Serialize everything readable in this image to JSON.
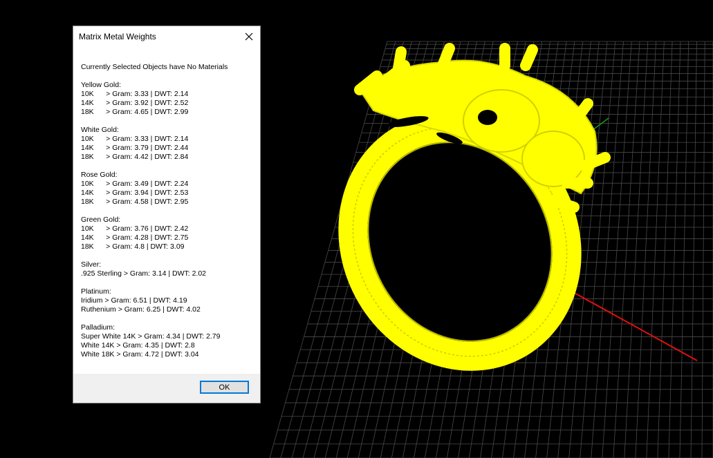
{
  "viewport": {
    "background": "#000000",
    "grid_color": "#4a4a4a",
    "x_axis_color": "#e01010",
    "y_axis_color": "#1a9a1a",
    "wireframe_color": "#ffff00"
  },
  "dialog": {
    "title": "Matrix Metal Weights",
    "close_icon": "close-icon",
    "header": "Currently Selected Objects have No Materials",
    "groups": [
      {
        "name": "Yellow Gold:",
        "rows": [
          "10K      > Gram: 3.33 | DWT: 2.14",
          "14K      > Gram: 3.92 | DWT: 2.52",
          "18K      > Gram: 4.65 | DWT: 2.99"
        ]
      },
      {
        "name": "White Gold:",
        "rows": [
          "10K      > Gram: 3.33 | DWT: 2.14",
          "14K      > Gram: 3.79 | DWT: 2.44",
          "18K      > Gram: 4.42 | DWT: 2.84"
        ]
      },
      {
        "name": "Rose Gold:",
        "rows": [
          "10K      > Gram: 3.49 | DWT: 2.24",
          "14K      > Gram: 3.94 | DWT: 2.53",
          "18K      > Gram: 4.58 | DWT: 2.95"
        ]
      },
      {
        "name": "Green Gold:",
        "rows": [
          "10K      > Gram: 3.76 | DWT: 2.42",
          "14K      > Gram: 4.28 | DWT: 2.75",
          "18K      > Gram: 4.8 | DWT: 3.09"
        ]
      },
      {
        "name": "Silver:",
        "rows": [
          ".925 Sterling > Gram: 3.14 | DWT: 2.02"
        ]
      },
      {
        "name": "Platinum:",
        "rows": [
          "Iridium > Gram: 6.51 | DWT: 4.19",
          "Ruthenium > Gram: 6.25 | DWT: 4.02"
        ]
      },
      {
        "name": "Palladium:",
        "rows": [
          "Super White 14K > Gram: 4.34 | DWT: 2.79",
          "White 14K > Gram: 4.35 | DWT: 2.8",
          "White 18K > Gram: 4.72 | DWT: 3.04"
        ]
      }
    ],
    "ok_label": "OK"
  }
}
